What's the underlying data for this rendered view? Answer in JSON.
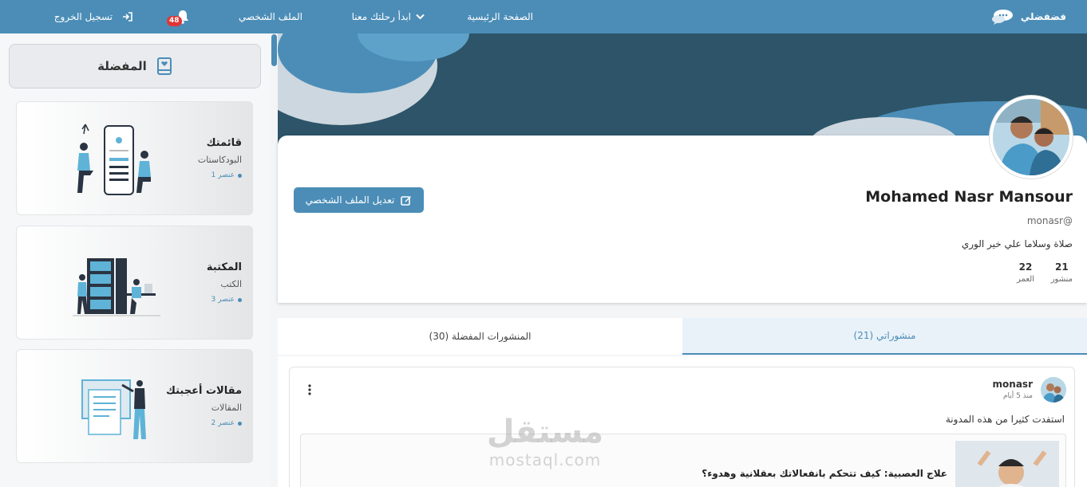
{
  "nav": {
    "logo": "فضفضلي",
    "home": "الصفحة الرئيسية",
    "journey": "ابدأ رحلتك معنا",
    "profile": "الملف الشخصي",
    "notifications_count": "48",
    "logout": "تسجيل الخروج"
  },
  "sidebar": {
    "header": "المفضلة",
    "cards": [
      {
        "title": "قائمتك",
        "subtitle": "البودكاستات",
        "count": "1 عنصر"
      },
      {
        "title": "المكتبة",
        "subtitle": "الكتب",
        "count": "3 عنصر"
      },
      {
        "title": "مقالات أعجبتك",
        "subtitle": "المقالات",
        "count": "2 عنصر"
      }
    ]
  },
  "profile": {
    "name": "Mohamed Nasr Mansour",
    "handle": "monasr@",
    "bio": "صلاة وسلاما علي خير الوري",
    "stats": [
      {
        "value": "21",
        "label": "منشور"
      },
      {
        "value": "22",
        "label": "العمر"
      }
    ],
    "edit_button": "تعديل الملف الشخصي"
  },
  "tabs": {
    "my_posts": "منشوراتي (21)",
    "favorite_posts": "المنشورات المفضلة (30)"
  },
  "post": {
    "username": "monasr",
    "time": "منذ 5 أيام",
    "text": "استفدت كثيرا من هذه المدونة",
    "embed_title": "علاج العصبية: كيف تتحكم بانفعالاتك بعقلانية وهدوء؟"
  },
  "watermark": {
    "arabic": "مستقل",
    "latin": "mostaql.com"
  },
  "colors": {
    "primary": "#4b8db7",
    "banner_dark": "#2d5468",
    "badge": "#e03636"
  }
}
